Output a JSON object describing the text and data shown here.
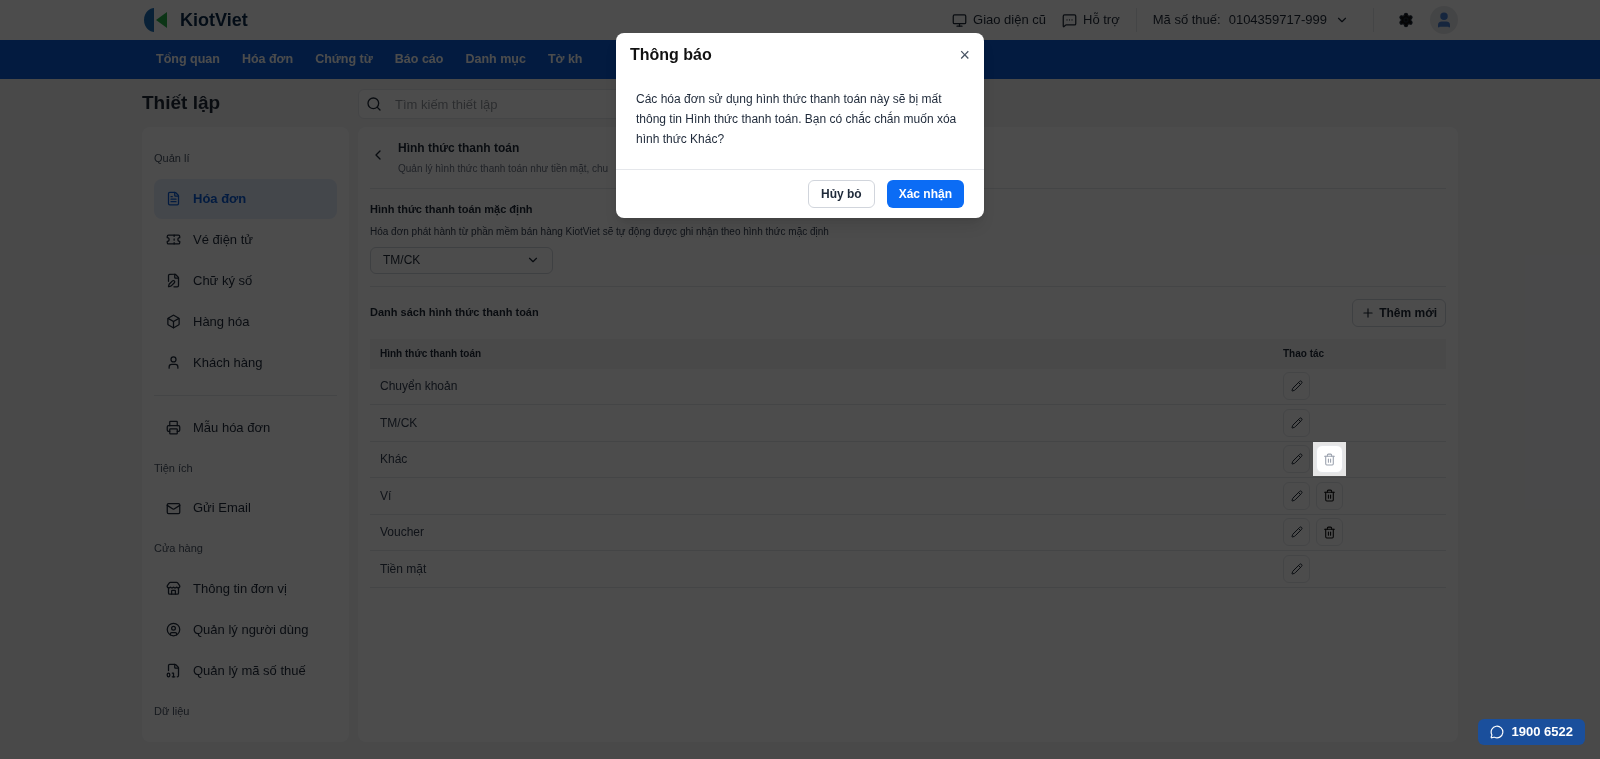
{
  "header": {
    "brand": "KiotViet",
    "links": [
      "Giao diện cũ",
      "Hỗ trợ"
    ],
    "tax_label": "Mã số thuế:",
    "tax_value": "0104359717-999"
  },
  "nav": [
    "Tổng quan",
    "Hóa đơn",
    "Chứng từ",
    "Báo cáo",
    "Danh mục",
    "Tờ kh"
  ],
  "page_title": "Thiết lập",
  "search": {
    "placeholder": "Tìm kiếm thiết lập"
  },
  "sidebar": [
    {
      "kind": "heading",
      "label": "Quản lí"
    },
    {
      "kind": "item",
      "label": "Hóa đơn",
      "selected": true
    },
    {
      "kind": "item",
      "label": "Vé điện tử",
      "selected": false
    },
    {
      "kind": "item",
      "label": "Chữ ký số",
      "selected": false
    },
    {
      "kind": "item",
      "label": "Hàng hóa",
      "selected": false
    },
    {
      "kind": "item",
      "label": "Khách hàng",
      "selected": false
    },
    {
      "kind": "divider"
    },
    {
      "kind": "item",
      "label": "Mẫu hóa đơn",
      "selected": false
    },
    {
      "kind": "heading",
      "label": "Tiện ích"
    },
    {
      "kind": "item",
      "label": "Gửi Email",
      "selected": false
    },
    {
      "kind": "heading",
      "label": "Cửa hàng"
    },
    {
      "kind": "item",
      "label": "Thông tin đơn vị",
      "selected": false
    },
    {
      "kind": "item",
      "label": "Quản lý người dùng",
      "selected": false
    },
    {
      "kind": "item",
      "label": "Quản lý mã số thuế",
      "selected": false
    },
    {
      "kind": "heading",
      "label": "Dữ liệu"
    }
  ],
  "section": {
    "title": "Hình thức thanh toán",
    "subtitle": "Quản lý hình thức thanh toán như tiền mặt, chu"
  },
  "default_method": {
    "title": "Hình thức thanh toán mặc định",
    "description": "Hóa đơn phát hành từ phần mềm bán hàng KiotViet sẽ tự động được ghi nhận theo hình thức mặc định",
    "value": "TM/CK"
  },
  "list": {
    "title": "Danh sách hình thức thanh toán",
    "add_button": "Thêm mới",
    "columns": [
      "Hình thức thanh toán",
      "Thao tác"
    ],
    "rows": [
      {
        "name": "Chuyển khoản",
        "deletable": false,
        "focused": false
      },
      {
        "name": "TM/CK",
        "deletable": false,
        "focused": false
      },
      {
        "name": "Khác",
        "deletable": true,
        "focused": true
      },
      {
        "name": "Ví",
        "deletable": true,
        "focused": false
      },
      {
        "name": "Voucher",
        "deletable": true,
        "focused": false
      },
      {
        "name": "Tiền mặt",
        "deletable": false,
        "focused": false
      }
    ]
  },
  "dialog": {
    "title": "Thông báo",
    "close": "×",
    "message": "Các hóa đơn sử dụng hình thức thanh toán này sẽ bị mất thông tin Hình thức thanh toán. Bạn có chắc chắn muốn xóa hình thức Khác?",
    "buttons": [
      {
        "kind": "secondary",
        "label": "Hủy bỏ"
      },
      {
        "kind": "primary",
        "label": "Xác nhận"
      }
    ]
  },
  "hotline": "1900 6522"
}
